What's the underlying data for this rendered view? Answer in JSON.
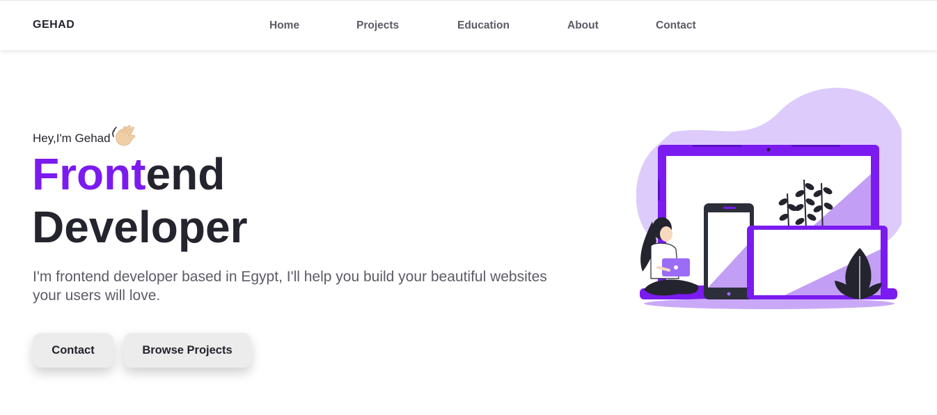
{
  "navbar": {
    "brand": "GEHAD",
    "links": [
      {
        "label": "Home"
      },
      {
        "label": "Projects"
      },
      {
        "label": "Education"
      },
      {
        "label": "About"
      },
      {
        "label": "Contact"
      }
    ]
  },
  "hero": {
    "greeting": "Hey,I'm Gehad",
    "greeting_icon": "waving-hand-icon",
    "title_accent": "Front",
    "title_rest": "end",
    "title_line2": "Developer",
    "description": "I'm frontend developer based in Egypt, I'll help you build your beautiful websites your users will love.",
    "buttons": {
      "contact": "Contact",
      "browse": "Browse Projects"
    },
    "illustration": "developer-devices-illustration"
  },
  "colors": {
    "accent": "#7b1bf0",
    "accent_light": "#dccbfb",
    "accent_mid": "#c29ff4",
    "text_dark": "#24242e",
    "text_muted": "#5b5b66",
    "button_bg": "#ececec"
  }
}
